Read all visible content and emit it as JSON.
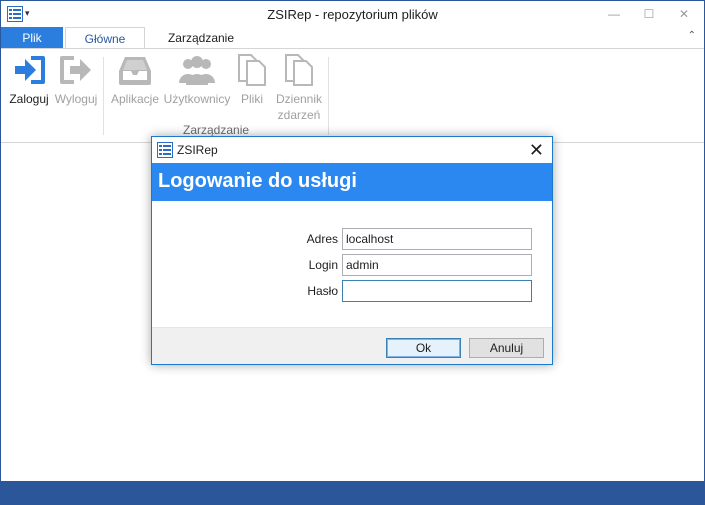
{
  "window": {
    "title": "ZSIRep - repozytorium plików",
    "minimize": "—",
    "maximize": "☐",
    "close": "✕",
    "qa_arrow": "▾"
  },
  "tabs": {
    "file": "Plik",
    "home": "Główne",
    "manage": "Zarządzanie",
    "collapse": "⌃"
  },
  "ribbon": {
    "login": "Zaloguj",
    "logout": "Wyloguj",
    "applications": "Aplikacje",
    "users": "Użytkownicy",
    "files": "Pliki",
    "event_log_1": "Dziennik",
    "event_log_2": "zdarzeń",
    "group_manage": "Zarządzanie"
  },
  "dialog": {
    "title": "ZSIRep",
    "close": "✕",
    "header": "Logowanie do usługi",
    "fields": {
      "address_label": "Adres",
      "address_value": "localhost",
      "login_label": "Login",
      "login_value": "admin",
      "password_label": "Hasło",
      "password_value": ""
    },
    "ok": "Ok",
    "cancel": "Anuluj"
  },
  "colors": {
    "accent": "#2b88f0",
    "file_tab": "#2b7dde",
    "statusbar": "#2b579a"
  }
}
